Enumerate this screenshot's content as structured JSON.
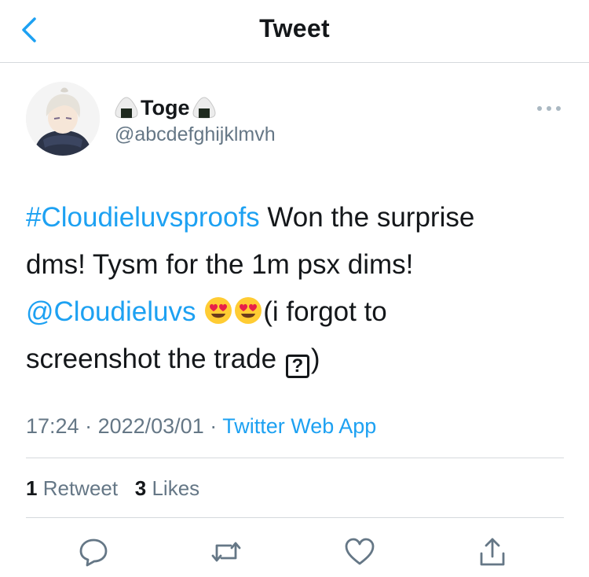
{
  "header": {
    "title": "Tweet"
  },
  "user": {
    "display_name": "Toge",
    "handle": "@abcdefghijklmvh"
  },
  "tweet": {
    "hashtag": "#Cloudieluvsproofs",
    "line1_rest": " Won the surprise",
    "line2": "dms! Tysm for the 1m psx dims!",
    "mention": "@Cloudieluvs",
    "line3_rest": "(i forgot to",
    "line4_start": "screenshot the trade ",
    "qbox_char": "?",
    "line4_end": ")"
  },
  "meta": {
    "time": "17:24",
    "date": "2022/03/01",
    "source": "Twitter Web App",
    "sep": " · "
  },
  "stats": {
    "retweets_count": "1",
    "retweets_label": "Retweet",
    "likes_count": "3",
    "likes_label": "Likes"
  },
  "colors": {
    "link": "#1da1f2",
    "secondary": "#657786",
    "divider": "#d5d9dd"
  },
  "icons": [
    "back-chevron-icon",
    "onigiri-icon",
    "more-icon",
    "heart-eyes-emoji",
    "reply-icon",
    "retweet-icon",
    "like-icon",
    "share-icon"
  ]
}
